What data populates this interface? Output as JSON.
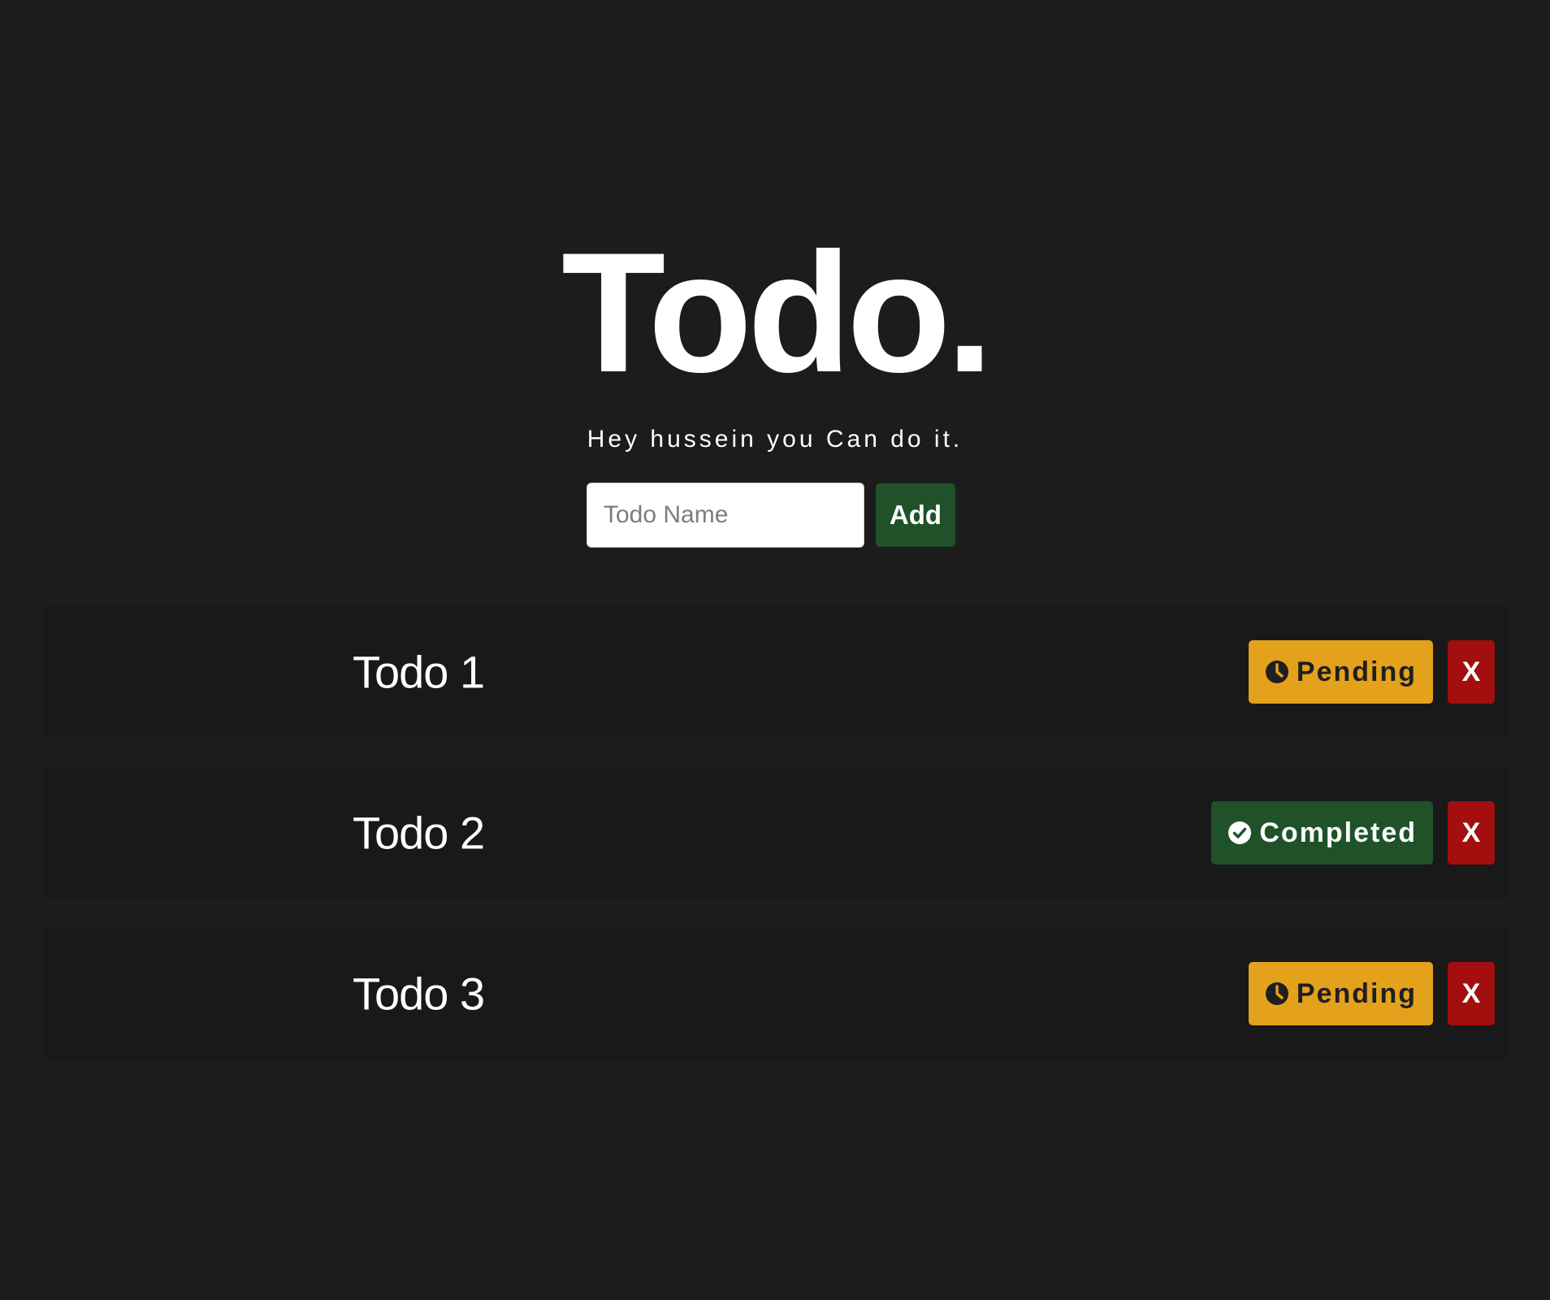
{
  "header": {
    "title": "Todo.",
    "subtitle": "Hey hussein you Can do it."
  },
  "form": {
    "input_placeholder": "Todo Name",
    "input_value": "",
    "add_label": "Add"
  },
  "todos": [
    {
      "name": "Todo 1",
      "status": "Pending",
      "status_icon": "clock-icon",
      "delete_label": "X"
    },
    {
      "name": "Todo 2",
      "status": "Completed",
      "status_icon": "check-circle-icon",
      "delete_label": "X"
    },
    {
      "name": "Todo 3",
      "status": "Pending",
      "status_icon": "clock-icon",
      "delete_label": "X"
    }
  ],
  "colors": {
    "background": "#1c1c1c",
    "item_background": "#191919",
    "pending": "#e4a11c",
    "completed": "#1f5229",
    "delete": "#a30f0f",
    "add_button": "#1f5229"
  }
}
